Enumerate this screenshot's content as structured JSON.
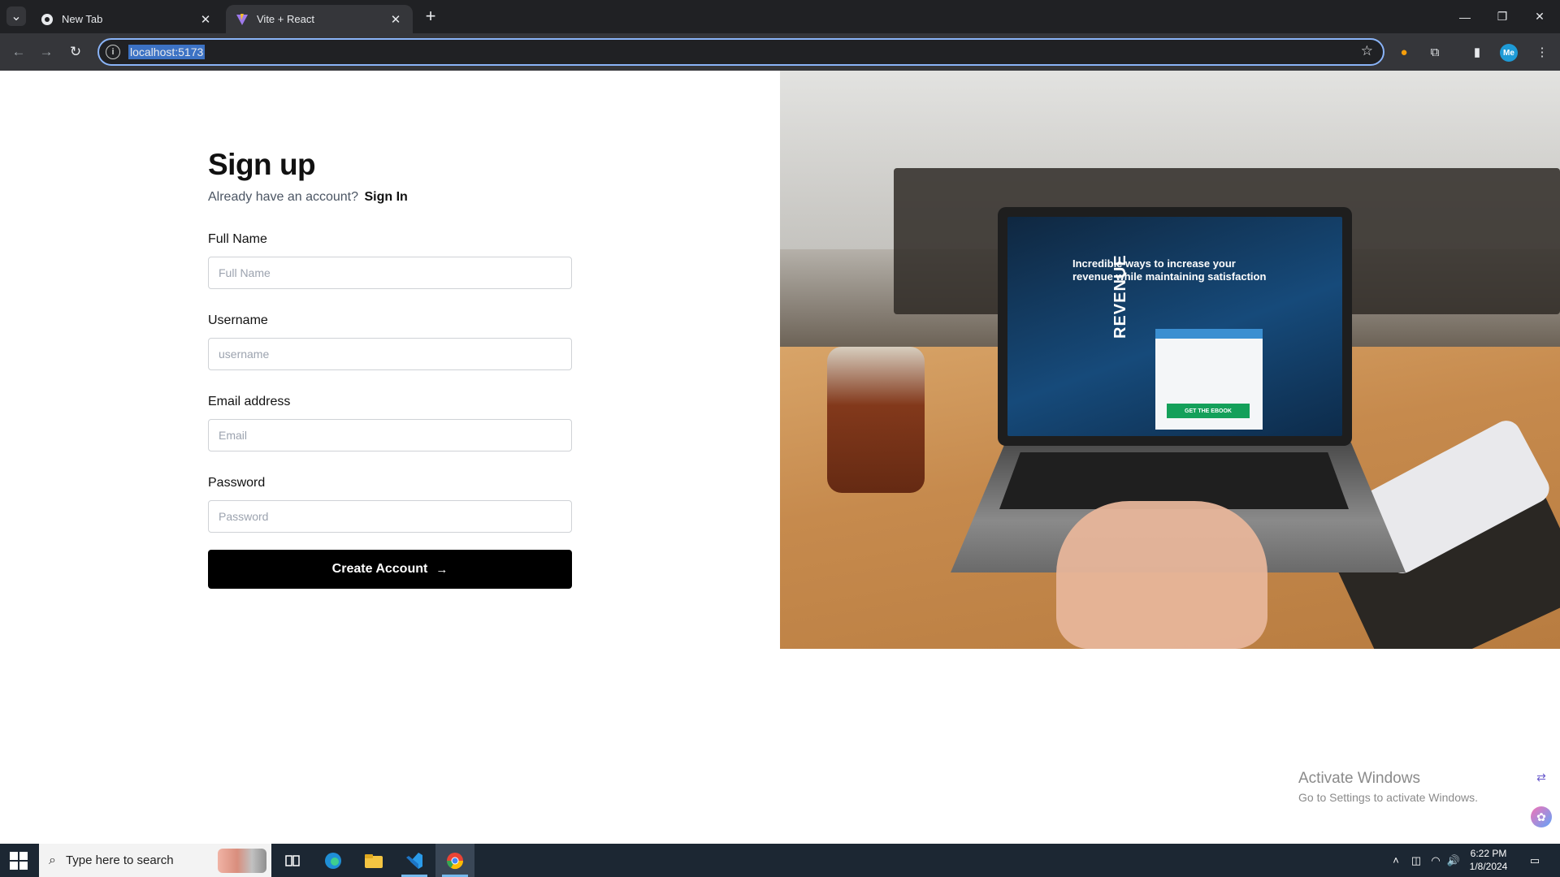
{
  "browser": {
    "tabs": [
      {
        "title": "New Tab",
        "active": false
      },
      {
        "title": "Vite + React",
        "active": true
      }
    ],
    "address": "localhost:5173",
    "profile_initials": "Me"
  },
  "signup": {
    "title": "Sign up",
    "subtitle_prefix": "Already have an account?",
    "signin_link": "Sign In",
    "fields": [
      {
        "label": "Full Name",
        "placeholder": "Full Name",
        "type": "text"
      },
      {
        "label": "Username",
        "placeholder": "username",
        "type": "text"
      },
      {
        "label": "Email address",
        "placeholder": "Email",
        "type": "email"
      },
      {
        "label": "Password",
        "placeholder": "Password",
        "type": "password"
      }
    ],
    "submit_label": "Create Account"
  },
  "hero_image": {
    "screen_headline": "Incredible ways to increase your revenue while maintaining satisfaction",
    "screen_vertical": "REVENUE",
    "screen_cta": "GET THE EBOOK"
  },
  "watermark": {
    "line1": "Activate Windows",
    "line2": "Go to Settings to activate Windows."
  },
  "taskbar": {
    "search_placeholder": "Type here to search",
    "time": "6:22 PM",
    "date": "1/8/2024"
  },
  "colors": {
    "primary_button": "#000000",
    "chrome_dark": "#202124",
    "chrome_toolbar": "#35363a",
    "taskbar": "#1c2733"
  }
}
